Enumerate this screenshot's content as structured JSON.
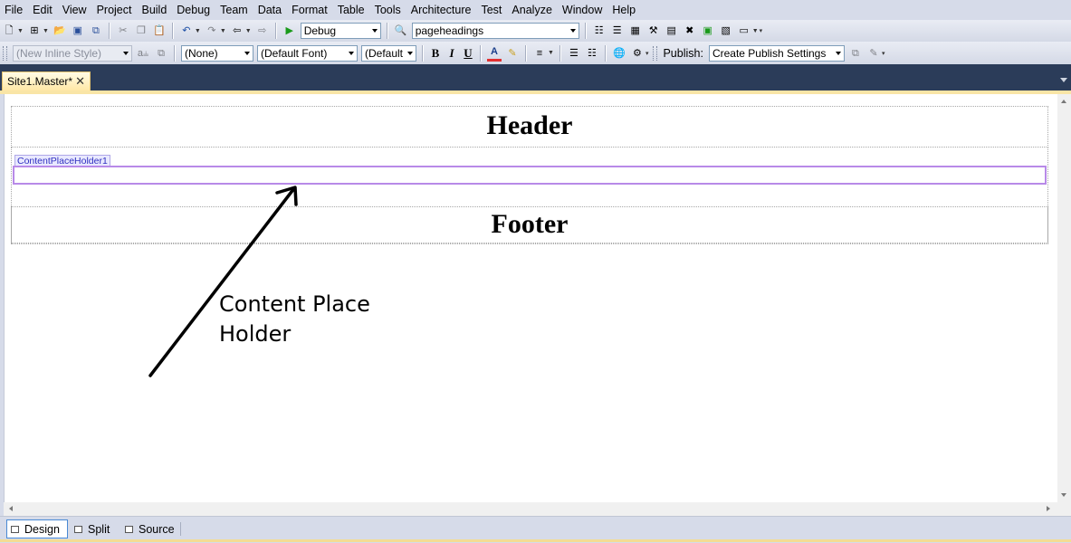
{
  "menu": [
    "File",
    "Edit",
    "View",
    "Project",
    "Build",
    "Debug",
    "Team",
    "Data",
    "Format",
    "Table",
    "Tools",
    "Architecture",
    "Test",
    "Analyze",
    "Window",
    "Help"
  ],
  "toolbar1": {
    "config_value": "Debug",
    "find_value": "pageheadings"
  },
  "toolbar2": {
    "style_value": "(New Inline Style)",
    "block_format_value": "(None)",
    "font_value": "(Default Font)",
    "font_size_value": "(Default",
    "bold": "B",
    "italic": "I",
    "underline": "U",
    "publish_label": "Publish:",
    "publish_value": "Create Publish Settings"
  },
  "document_tab": {
    "label": "Site1.Master*",
    "close": "✕"
  },
  "designer": {
    "header_text": "Header",
    "placeholder_label": "ContentPlaceHolder1",
    "footer_text": "Footer",
    "annotation_line1": "Content Place",
    "annotation_line2": "Holder"
  },
  "view_tabs": [
    "Design",
    "Split",
    "Source"
  ],
  "colors": {
    "chrome": "#d6dbe9",
    "tabstrip": "#2b3c59",
    "placeholder_border": "#b88ae8"
  }
}
